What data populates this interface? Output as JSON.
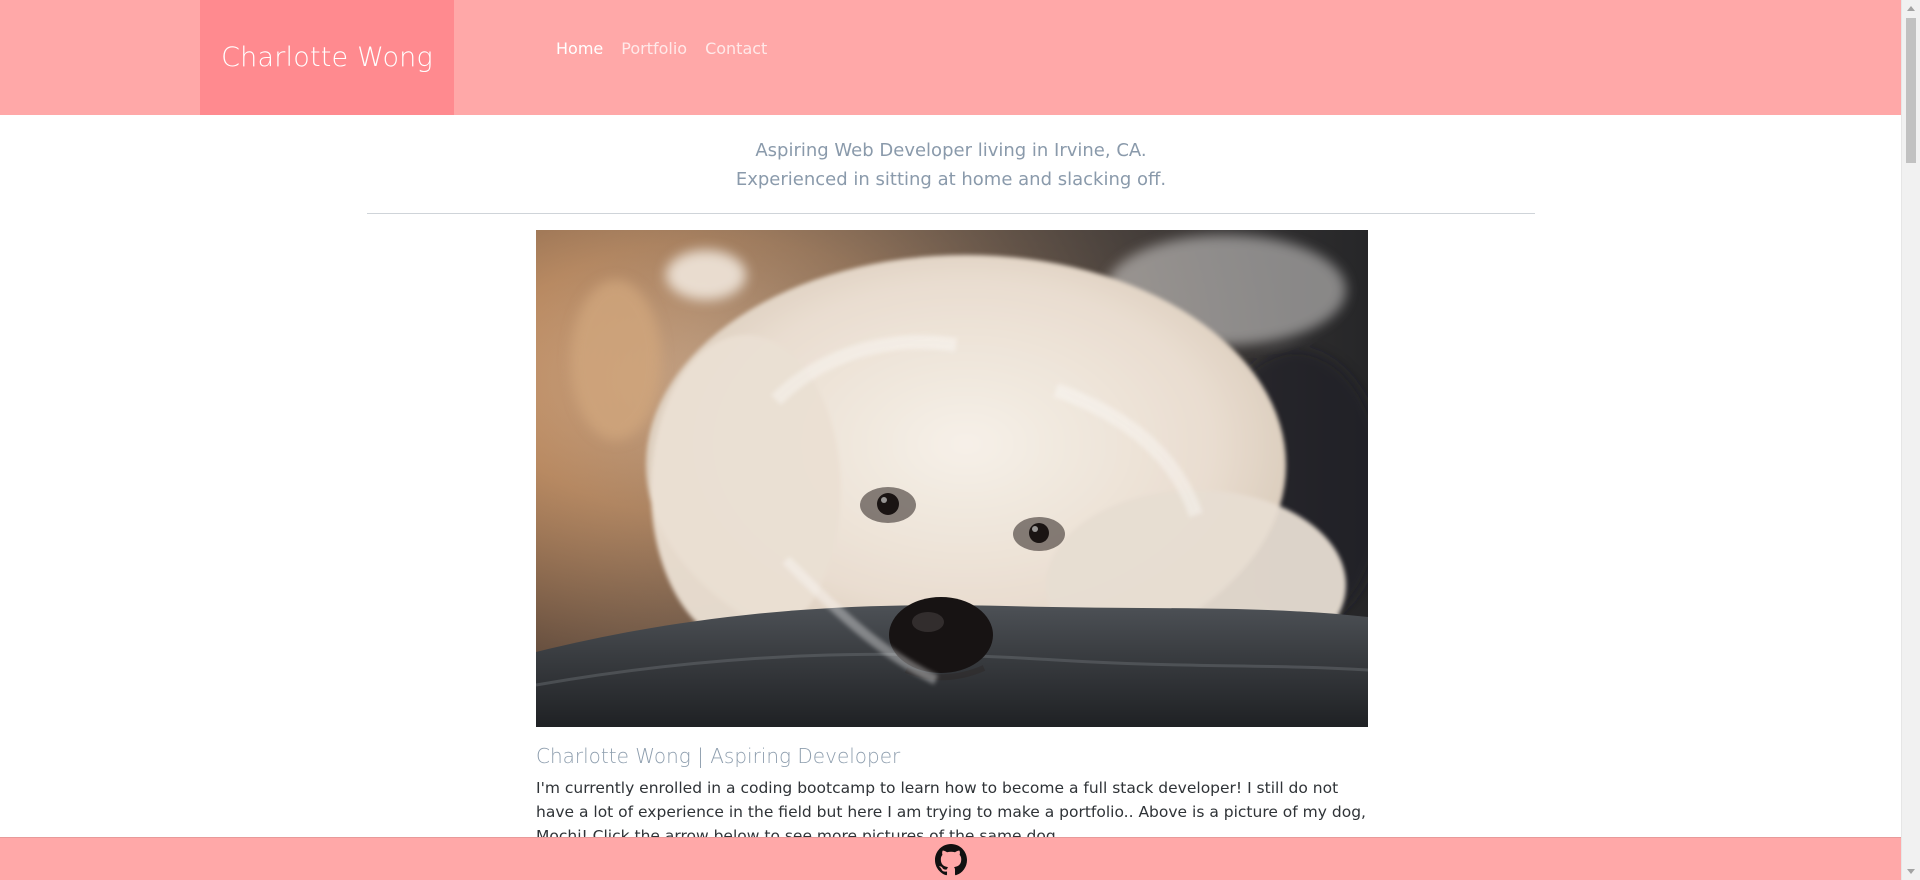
{
  "navbar": {
    "brand": "Charlotte Wong",
    "links": [
      {
        "label": "Home",
        "active": true
      },
      {
        "label": "Portfolio",
        "active": false
      },
      {
        "label": "Contact",
        "active": false
      }
    ]
  },
  "intro": {
    "line1": "Aspiring Web Developer living in Irvine, CA.",
    "line2": "Experienced in sitting at home and slacking off."
  },
  "hero": {
    "subject": "white poodle dog"
  },
  "caption": {
    "title": "Charlotte Wong | Aspiring Developer",
    "text": "I'm currently enrolled in a coding bootcamp to learn how to become a full stack developer! I still do not have a lot of experience in the field but here I am trying to make a portfolio.. Above is a picture of my dog, Mochi! Click the arrow below to see more pictures of the same dog."
  },
  "footer": {
    "icon": "github-icon"
  },
  "colors": {
    "navbar": "#ffa8a8",
    "brand_bg": "#ff8a8f",
    "muted_text": "#8a9aab"
  }
}
